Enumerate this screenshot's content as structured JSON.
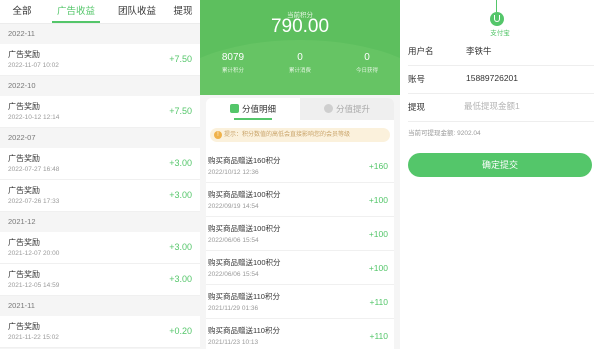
{
  "panel1": {
    "tabs": [
      "全部",
      "广告收益",
      "团队收益",
      "提现"
    ],
    "groups": [
      {
        "month": "2022-11",
        "items": [
          {
            "title": "广告奖励",
            "time": "2022-11-07 10:02",
            "amount": "+7.50"
          }
        ]
      },
      {
        "month": "2022-10",
        "items": [
          {
            "title": "广告奖励",
            "time": "2022-10-12 12:14",
            "amount": "+7.50"
          }
        ]
      },
      {
        "month": "2022-07",
        "items": [
          {
            "title": "广告奖励",
            "time": "2022-07-27 16:48",
            "amount": "+3.00"
          },
          {
            "title": "广告奖励",
            "time": "2022-07-26 17:33",
            "amount": "+3.00"
          }
        ]
      },
      {
        "month": "2021-12",
        "items": [
          {
            "title": "广告奖励",
            "time": "2021-12-07 20:00",
            "amount": "+3.00"
          },
          {
            "title": "广告奖励",
            "time": "2021-12-05 14:59",
            "amount": "+3.00"
          }
        ]
      },
      {
        "month": "2021-11",
        "items": [
          {
            "title": "广告奖励",
            "time": "2021-11-22 15:02",
            "amount": "+0.20"
          }
        ]
      }
    ]
  },
  "panel2": {
    "current_label": "当前积分",
    "current_value": "790.00",
    "stats": [
      {
        "value": "8079",
        "label": "累计积分"
      },
      {
        "value": "0",
        "label": "累计消费"
      },
      {
        "value": "0",
        "label": "今日获得"
      }
    ],
    "tabs": [
      "分值明细",
      "分值提升"
    ],
    "tip": "提示：积分数值的高低会直接影响您的会员等级",
    "records": [
      {
        "title": "购买商品赠送160积分",
        "time": "2022/10/12 12:36",
        "amount": "+160"
      },
      {
        "title": "购买商品赠送100积分",
        "time": "2022/09/19 14:54",
        "amount": "+100"
      },
      {
        "title": "购买商品赠送100积分",
        "time": "2022/06/06 15:54",
        "amount": "+100"
      },
      {
        "title": "购买商品赠送100积分",
        "time": "2022/06/06 15:54",
        "amount": "+100"
      },
      {
        "title": "购买商品赠送110积分",
        "time": "2021/11/29 01:36",
        "amount": "+110"
      },
      {
        "title": "购买商品赠送110积分",
        "time": "2021/11/23 10:13",
        "amount": "+110"
      }
    ]
  },
  "panel3": {
    "logo_label": "支付宝",
    "fields": [
      {
        "label": "用户名",
        "value": "李铁牛"
      },
      {
        "label": "账号",
        "value": "15889726201"
      },
      {
        "label": "提现",
        "value": "",
        "placeholder": "最低提现金额1"
      }
    ],
    "available": "当前可提现金额: 9202.04",
    "submit": "确定提交"
  },
  "colors": {
    "accent": "#54c66a",
    "hero": "#5dbf5e",
    "tip_bg": "#fbf1dc"
  }
}
